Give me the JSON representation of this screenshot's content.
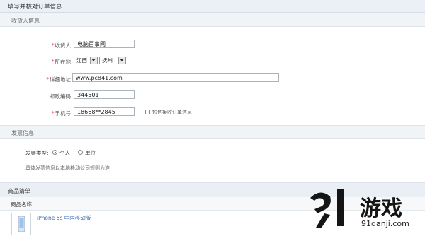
{
  "page_title": "填写并核对订单信息",
  "consignee_section": {
    "title": "收货人信息",
    "recipient": {
      "label": "收货人",
      "value": "电脑百事网"
    },
    "location": {
      "label": "所在地",
      "province": "江西",
      "city": "抚州"
    },
    "address": {
      "label": "详细地址",
      "value": "www.pc841.com"
    },
    "postcode": {
      "label": "邮政编码",
      "value": "344501"
    },
    "mobile": {
      "label": "手机号",
      "value": "18668**2845",
      "sms_option": "短信接收订单信息"
    }
  },
  "invoice_section": {
    "title": "发票信息",
    "type_label": "发票类型:",
    "options": [
      "个人",
      "单位"
    ],
    "selected": "个人",
    "note": "具体发票信息以本地移动公司规则为准"
  },
  "products_section": {
    "title": "商品清单",
    "column_header": "商品名称",
    "items": [
      {
        "name": "iPhone 5s 中国移动版"
      }
    ]
  },
  "watermark": {
    "brand": "游戏",
    "site": "91danji.com",
    "logo_text": "9l"
  },
  "colors": {
    "accent": "#3b6ab0",
    "required": "#e33333",
    "header_bg": "#eaf0f6",
    "watermark": "#1a1a1a"
  }
}
